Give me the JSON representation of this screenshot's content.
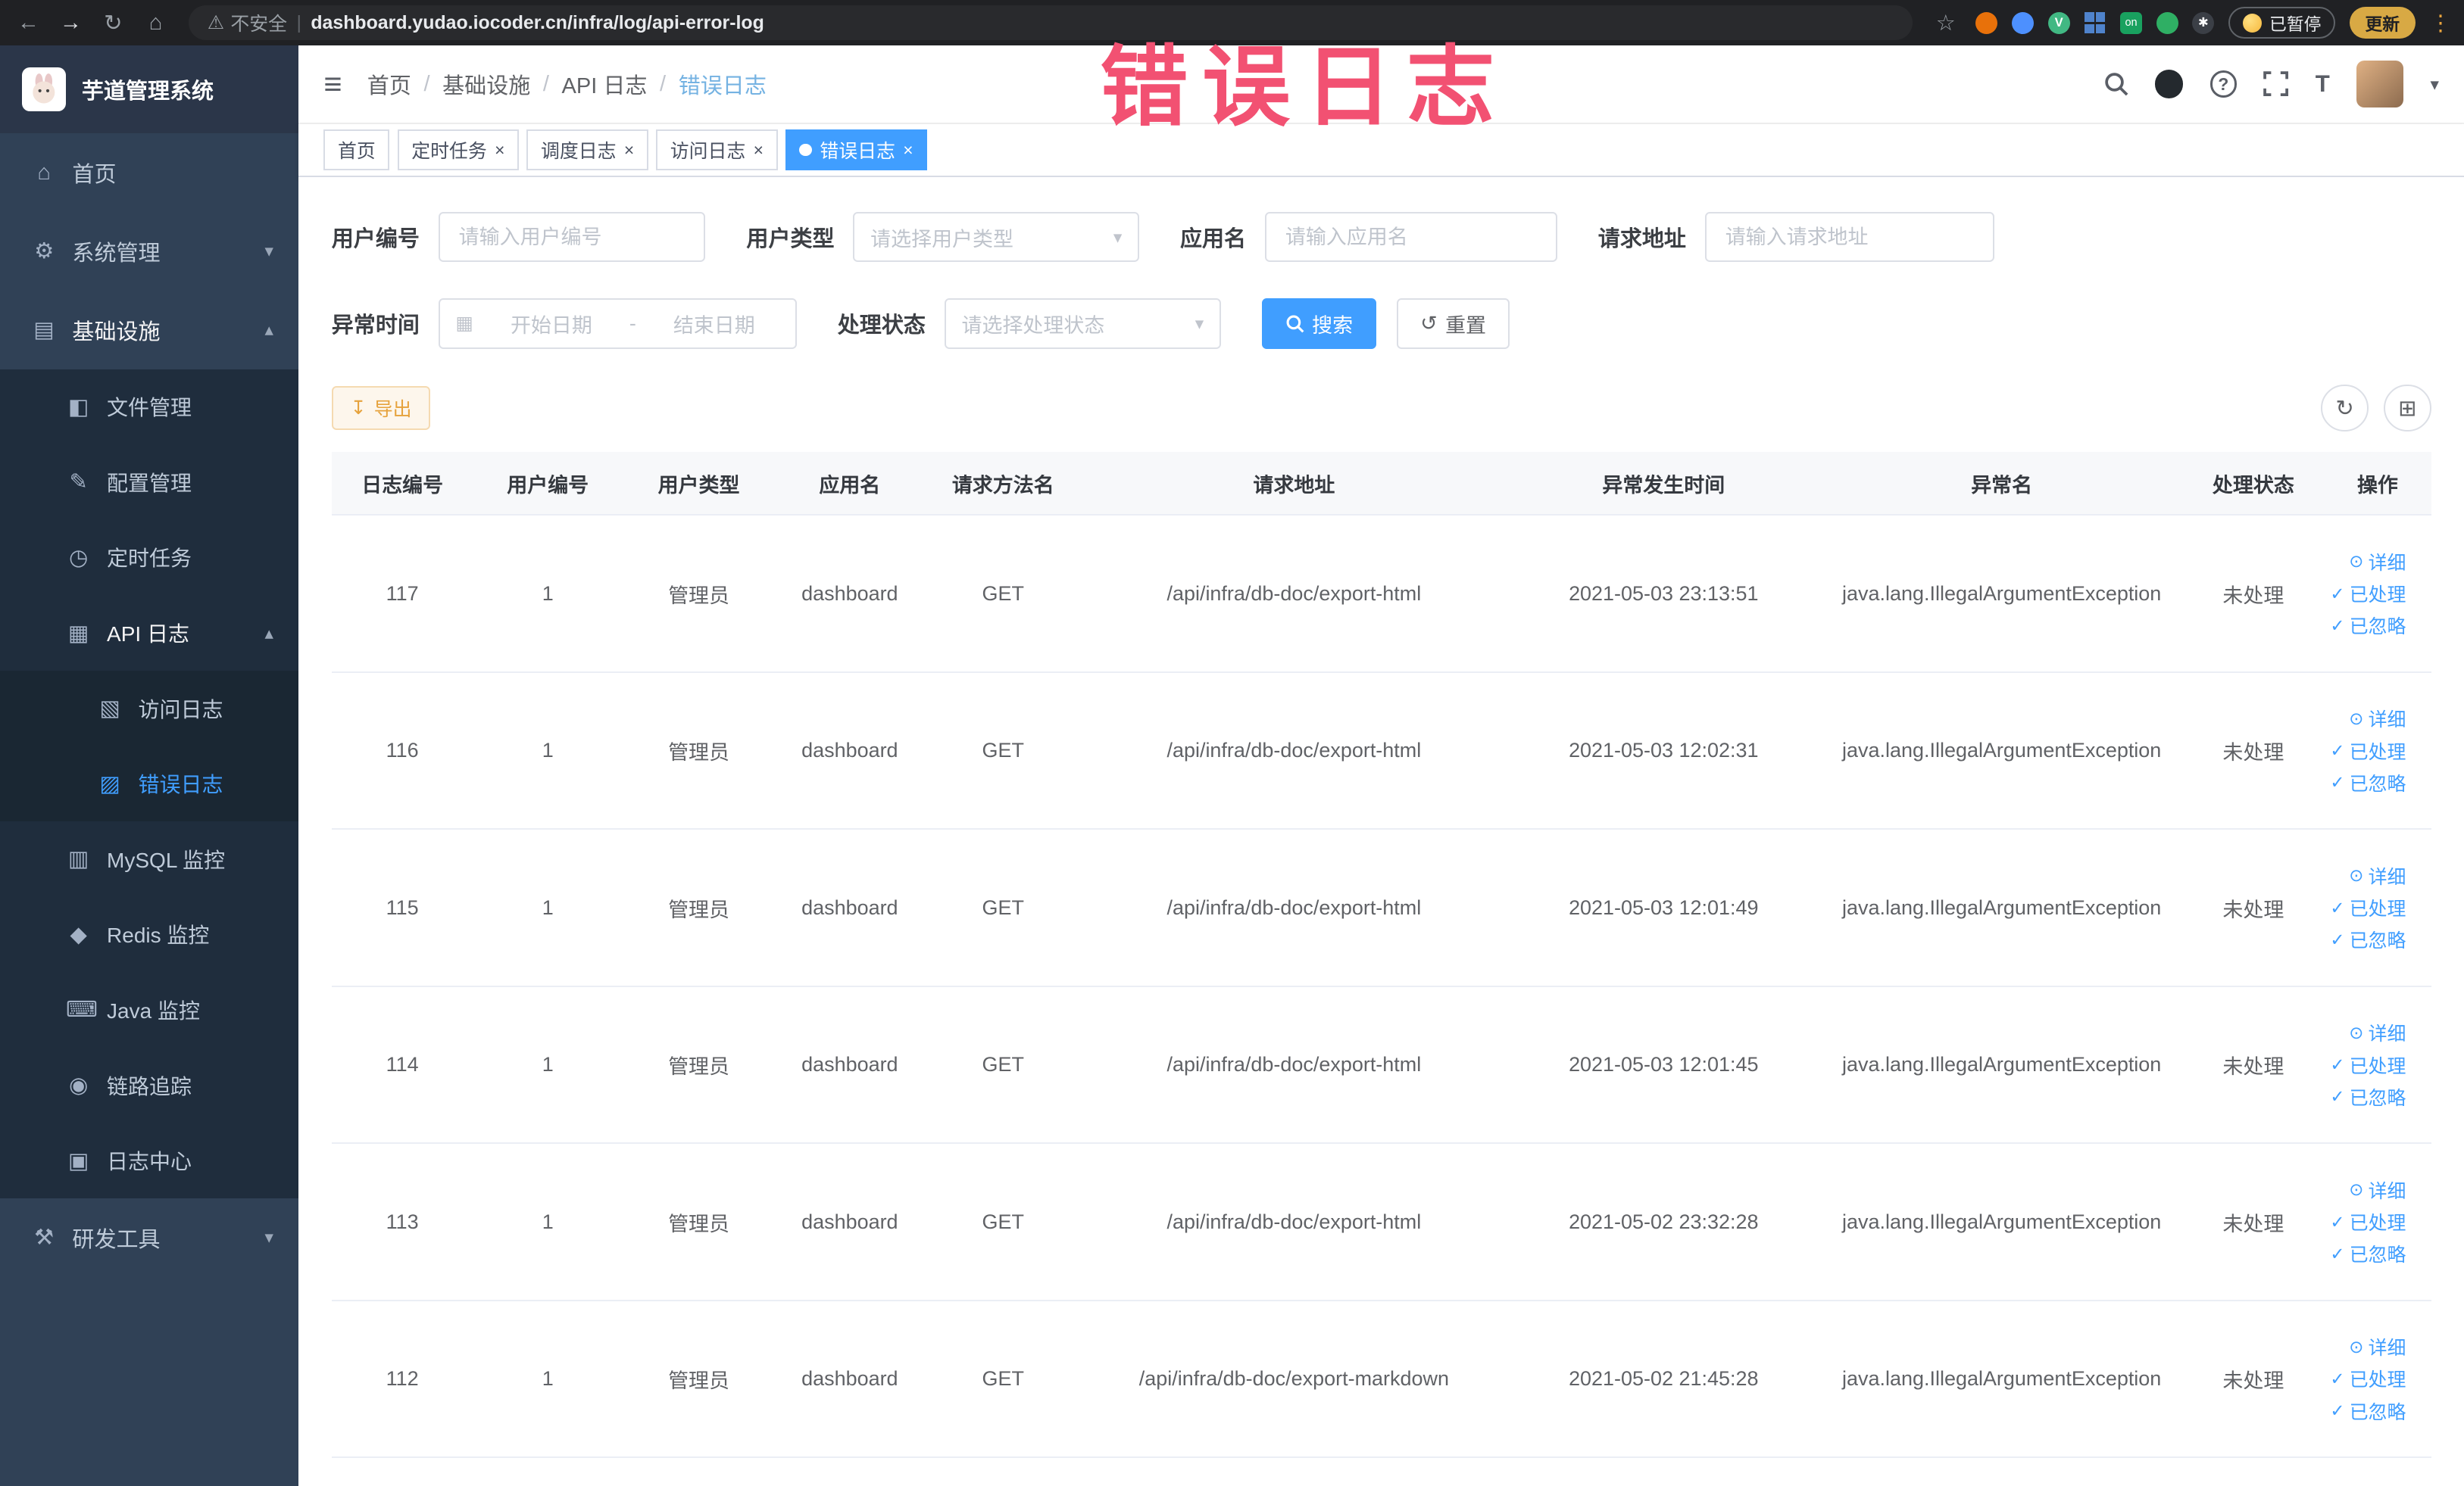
{
  "colors": {
    "primary": "#409eff",
    "warning": "#e6a23c",
    "sidebar_bg": "#304156",
    "submenu_bg": "#1f2d3d",
    "active_tab_bg": "#409eff",
    "annotation": "#f25172"
  },
  "icons": {
    "back": "←",
    "forward": "→",
    "reload": "↻",
    "home_nav": "⌂",
    "warning": "⚠",
    "star": "☆",
    "kebab": "⋮",
    "menu": "≡",
    "chevron_down": "▾",
    "chevron_up": "▴",
    "caret_down": "▾",
    "close": "×",
    "home": "⌂",
    "system": "⚙",
    "infra": "▤",
    "file": "◧",
    "config": "✎",
    "timer": "◷",
    "apilog": "▦",
    "accesslog": "▧",
    "errorlog": "▨",
    "mysql": "▥",
    "redis": "◆",
    "java": "⌨",
    "trace": "◉",
    "logcenter": "▣",
    "devtools": "⚒",
    "calendar": "▦",
    "download": "↧",
    "refresh": "↻",
    "reset": "↺",
    "columns": "⊞",
    "eye": "⊙",
    "check": "✓",
    "fontsize": "T",
    "paw": "✱",
    "ext_v": "V",
    "ext_on": "on",
    "help": "?"
  },
  "browser": {
    "security_label": "不安全",
    "url": "dashboard.yudao.iocoder.cn/infra/log/api-error-log",
    "paused_badge": "已暂停",
    "update_label": "更新"
  },
  "annotation": {
    "text": "错误日志"
  },
  "sidebar": {
    "title": "芋道管理系统",
    "items": [
      {
        "label": "首页"
      },
      {
        "label": "系统管理"
      },
      {
        "label": "基础设施"
      },
      {
        "label": "文件管理"
      },
      {
        "label": "配置管理"
      },
      {
        "label": "定时任务"
      },
      {
        "label": "API 日志"
      },
      {
        "label": "访问日志"
      },
      {
        "label": "错误日志"
      },
      {
        "label": "MySQL 监控"
      },
      {
        "label": "Redis 监控"
      },
      {
        "label": "Java 监控"
      },
      {
        "label": "链路追踪"
      },
      {
        "label": "日志中心"
      },
      {
        "label": "研发工具"
      }
    ]
  },
  "breadcrumb": {
    "separator": "/",
    "items": [
      "首页",
      "基础设施",
      "API 日志",
      "错误日志"
    ]
  },
  "tabs": [
    {
      "label": "首页"
    },
    {
      "label": "定时任务"
    },
    {
      "label": "调度日志"
    },
    {
      "label": "访问日志"
    },
    {
      "label": "错误日志"
    }
  ],
  "filters": {
    "user_id_label": "用户编号",
    "user_id_placeholder": "请输入用户编号",
    "user_type_label": "用户类型",
    "user_type_placeholder": "请选择用户类型",
    "app_label": "应用名",
    "app_placeholder": "请输入应用名",
    "url_label": "请求地址",
    "url_placeholder": "请输入请求地址",
    "time_label": "异常时间",
    "time_start_placeholder": "开始日期",
    "time_separator": "-",
    "time_end_placeholder": "结束日期",
    "status_label": "处理状态",
    "status_placeholder": "请选择处理状态",
    "search_label": "搜索",
    "reset_label": "重置"
  },
  "toolbar": {
    "export_label": "导出"
  },
  "table": {
    "columns": [
      "日志编号",
      "用户编号",
      "用户类型",
      "应用名",
      "请求方法名",
      "请求地址",
      "异常发生时间",
      "异常名",
      "处理状态",
      "操作"
    ],
    "action_labels": {
      "detail": "详细",
      "processed": "已处理",
      "ignored": "已忽略"
    },
    "rows": [
      {
        "id": "117",
        "user_id": "1",
        "user_type": "管理员",
        "app_name": "dashboard",
        "method": "GET",
        "url": "/api/infra/db-doc/export-html",
        "time": "2021-05-03 23:13:51",
        "exception": "java.lang.IllegalArgumentException",
        "status": "未处理"
      },
      {
        "id": "116",
        "user_id": "1",
        "user_type": "管理员",
        "app_name": "dashboard",
        "method": "GET",
        "url": "/api/infra/db-doc/export-html",
        "time": "2021-05-03 12:02:31",
        "exception": "java.lang.IllegalArgumentException",
        "status": "未处理"
      },
      {
        "id": "115",
        "user_id": "1",
        "user_type": "管理员",
        "app_name": "dashboard",
        "method": "GET",
        "url": "/api/infra/db-doc/export-html",
        "time": "2021-05-03 12:01:49",
        "exception": "java.lang.IllegalArgumentException",
        "status": "未处理"
      },
      {
        "id": "114",
        "user_id": "1",
        "user_type": "管理员",
        "app_name": "dashboard",
        "method": "GET",
        "url": "/api/infra/db-doc/export-html",
        "time": "2021-05-03 12:01:45",
        "exception": "java.lang.IllegalArgumentException",
        "status": "未处理"
      },
      {
        "id": "113",
        "user_id": "1",
        "user_type": "管理员",
        "app_name": "dashboard",
        "method": "GET",
        "url": "/api/infra/db-doc/export-html",
        "time": "2021-05-02 23:32:28",
        "exception": "java.lang.IllegalArgumentException",
        "status": "未处理"
      },
      {
        "id": "112",
        "user_id": "1",
        "user_type": "管理员",
        "app_name": "dashboard",
        "method": "GET",
        "url": "/api/infra/db-doc/export-markdown",
        "time": "2021-05-02 21:45:28",
        "exception": "java.lang.IllegalArgumentException",
        "status": "未处理"
      }
    ]
  }
}
